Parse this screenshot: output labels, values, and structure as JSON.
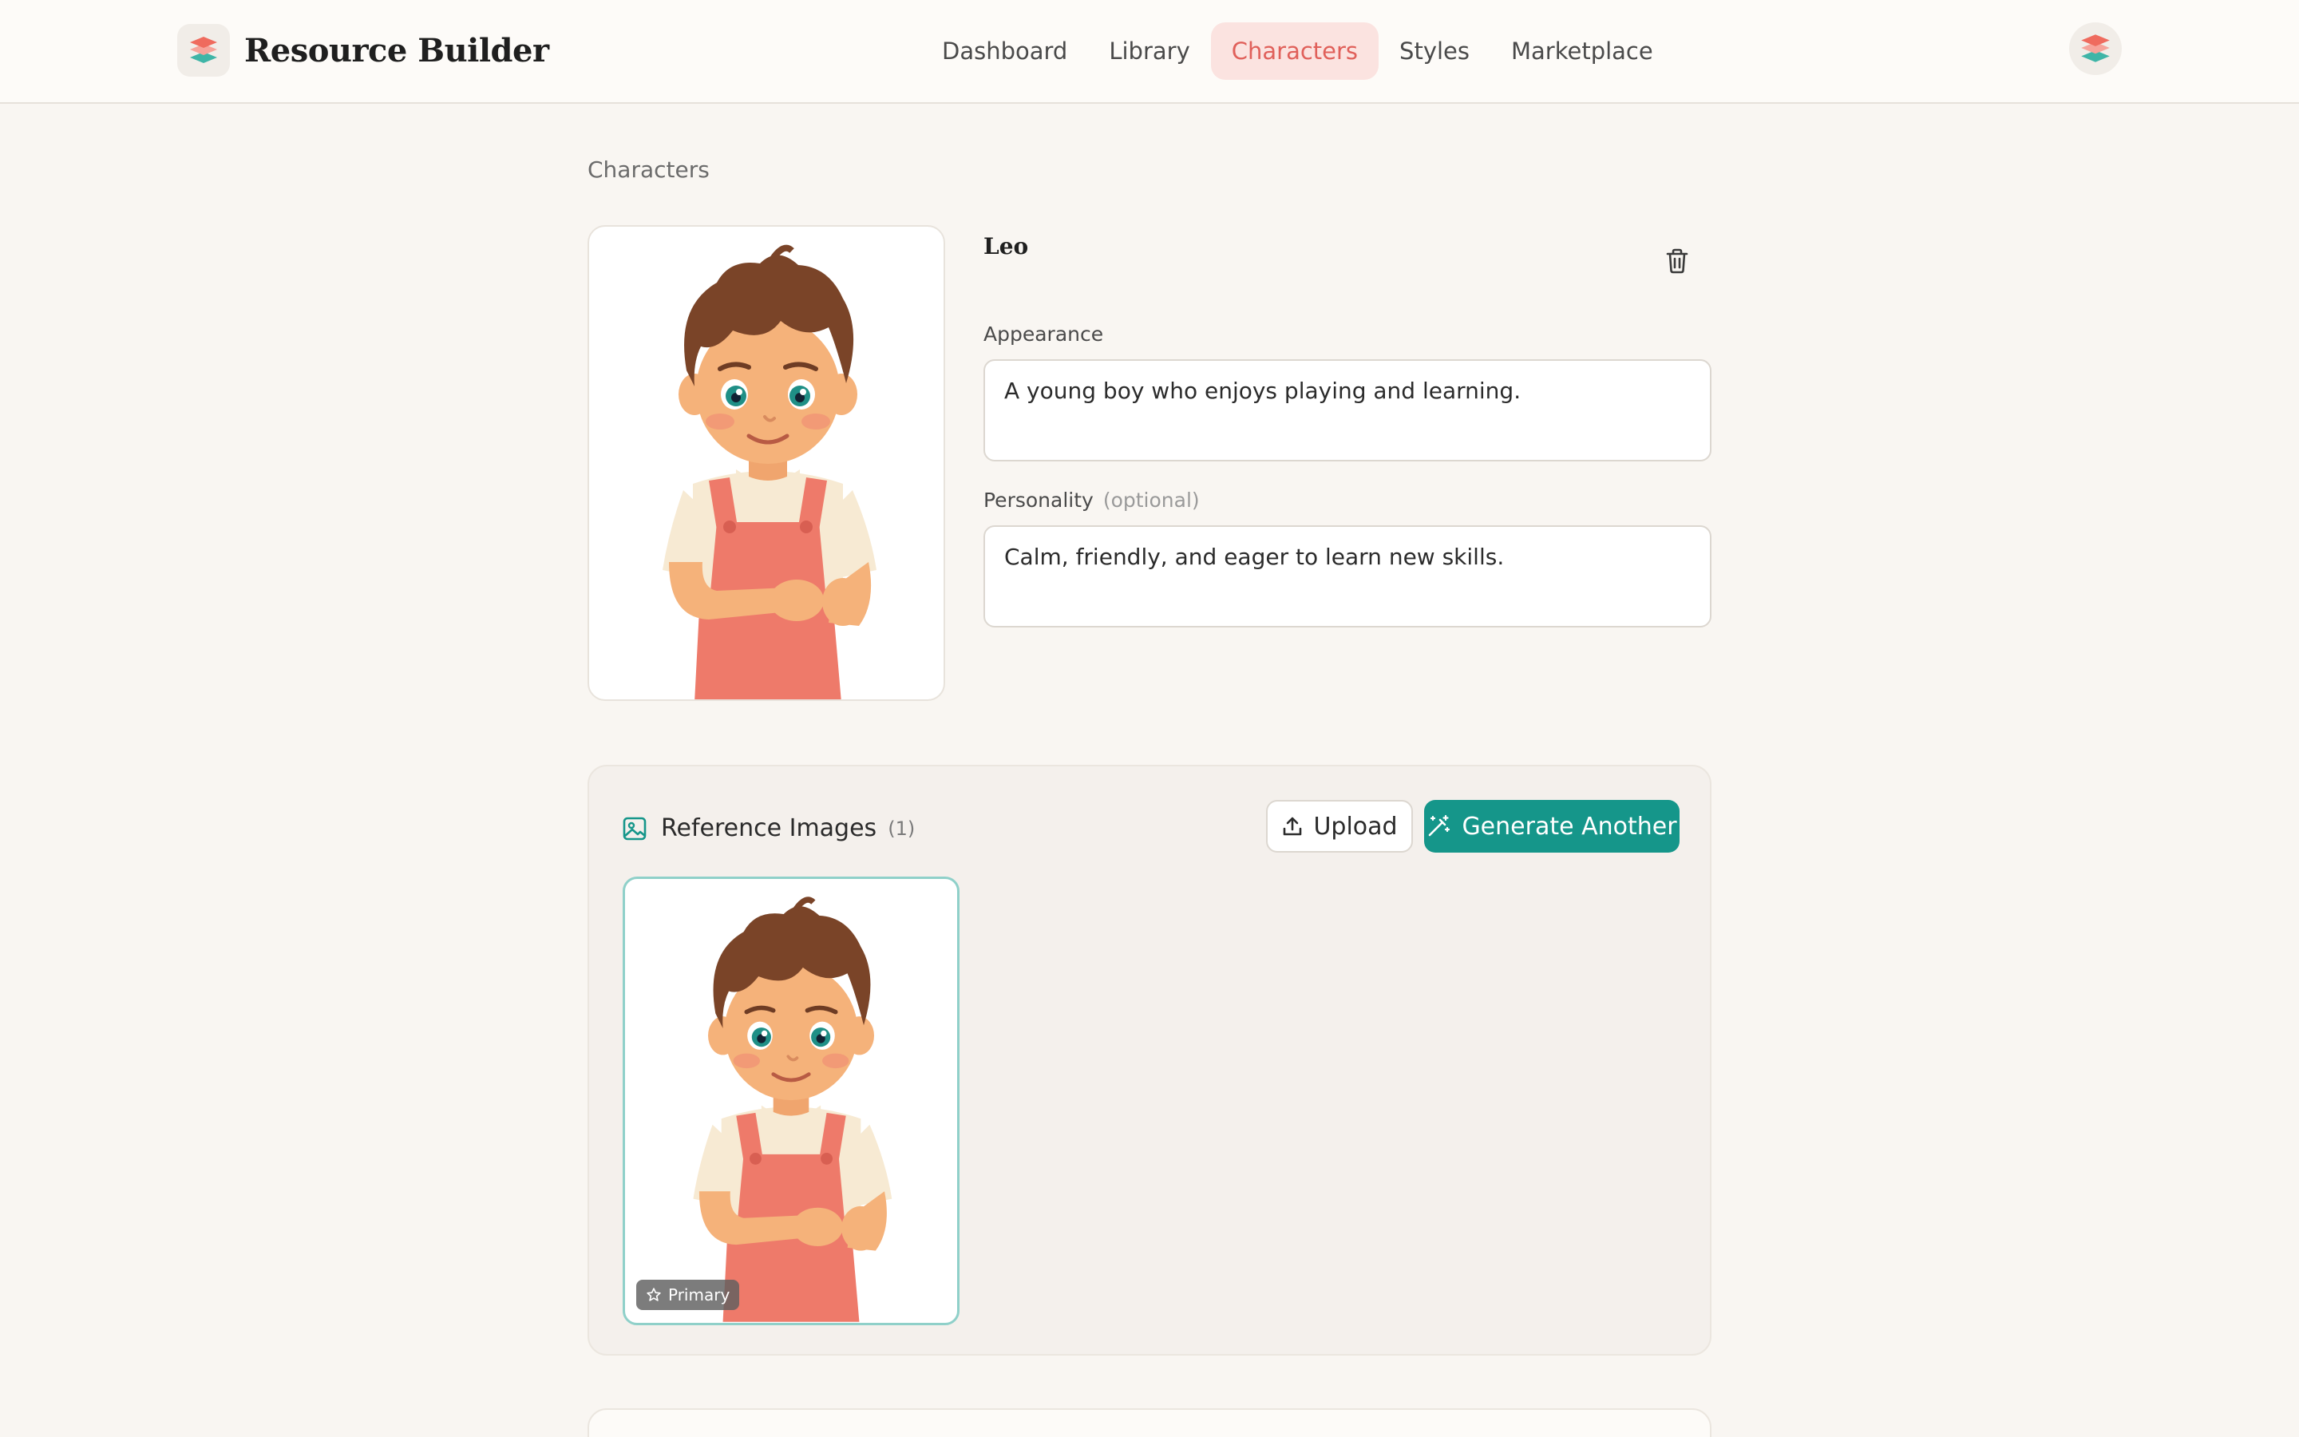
{
  "app": {
    "name": "Resource Builder"
  },
  "nav": {
    "items": [
      {
        "label": "Dashboard",
        "active": false
      },
      {
        "label": "Library",
        "active": false
      },
      {
        "label": "Characters",
        "active": true
      },
      {
        "label": "Styles",
        "active": false
      },
      {
        "label": "Marketplace",
        "active": false
      }
    ]
  },
  "breadcrumb": "Characters",
  "character": {
    "name": "Leo",
    "appearance": {
      "label": "Appearance",
      "value": "A young boy who enjoys playing and learning."
    },
    "personality": {
      "label": "Personality",
      "optional": "(optional)",
      "value": "Calm, friendly, and eager to learn new skills."
    }
  },
  "references": {
    "title": "Reference Images",
    "count": "(1)",
    "upload_label": "Upload",
    "generate_label": "Generate Another",
    "primary_badge": "Primary"
  },
  "colors": {
    "background": "#f9f6f2",
    "accent_teal": "#15968a",
    "nav_active_bg": "#fbe3e0",
    "nav_active_text": "#e0605a",
    "logo_coral": "#ef6b5e",
    "logo_teal": "#3fb5a7"
  },
  "icons": [
    "layers-logo-icon",
    "trash-icon",
    "image-icon",
    "upload-icon",
    "magic-wand-icon",
    "star-icon"
  ]
}
